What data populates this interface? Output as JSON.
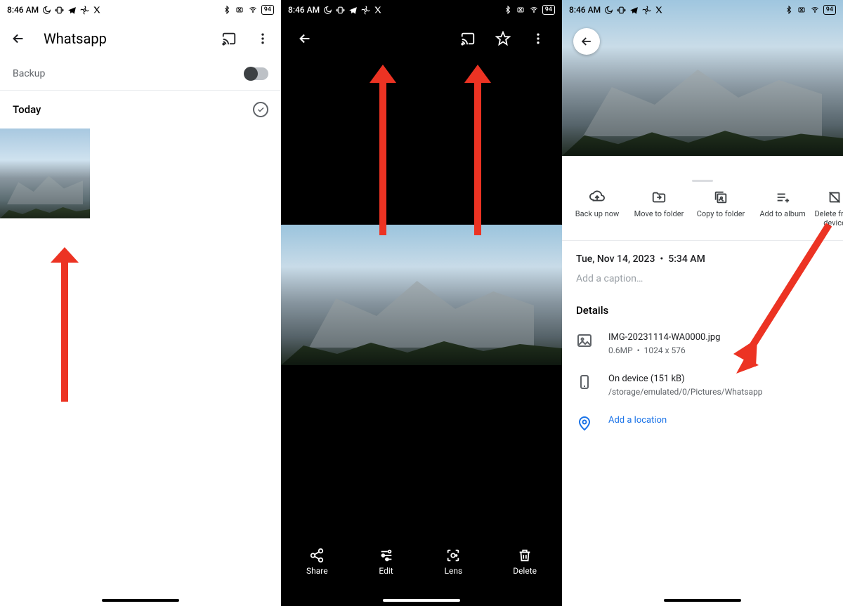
{
  "status": {
    "time": "8:46 AM",
    "battery": "94"
  },
  "panel1": {
    "title": "Whatsapp",
    "backup_label": "Backup",
    "section": "Today"
  },
  "panel2": {
    "actions": {
      "share": "Share",
      "edit": "Edit",
      "lens": "Lens",
      "delete": "Delete"
    }
  },
  "panel3": {
    "actions": {
      "backup": "Back up now",
      "move": "Move to folder",
      "copy": "Copy to folder",
      "album": "Add to album",
      "delete": "Delete from device"
    },
    "date": "Tue, Nov 14, 2023",
    "time": "5:34 AM",
    "date_sep": "•",
    "caption_placeholder": "Add a caption…",
    "details_heading": "Details",
    "file": {
      "name": "IMG-20231114-WA0000.jpg",
      "mp": "0.6MP",
      "sep": "•",
      "dims": "1024 x 576"
    },
    "device": {
      "title": "On device (151 kB)",
      "path": "/storage/emulated/0/Pictures/Whatsapp"
    },
    "location_link": "Add a location"
  }
}
